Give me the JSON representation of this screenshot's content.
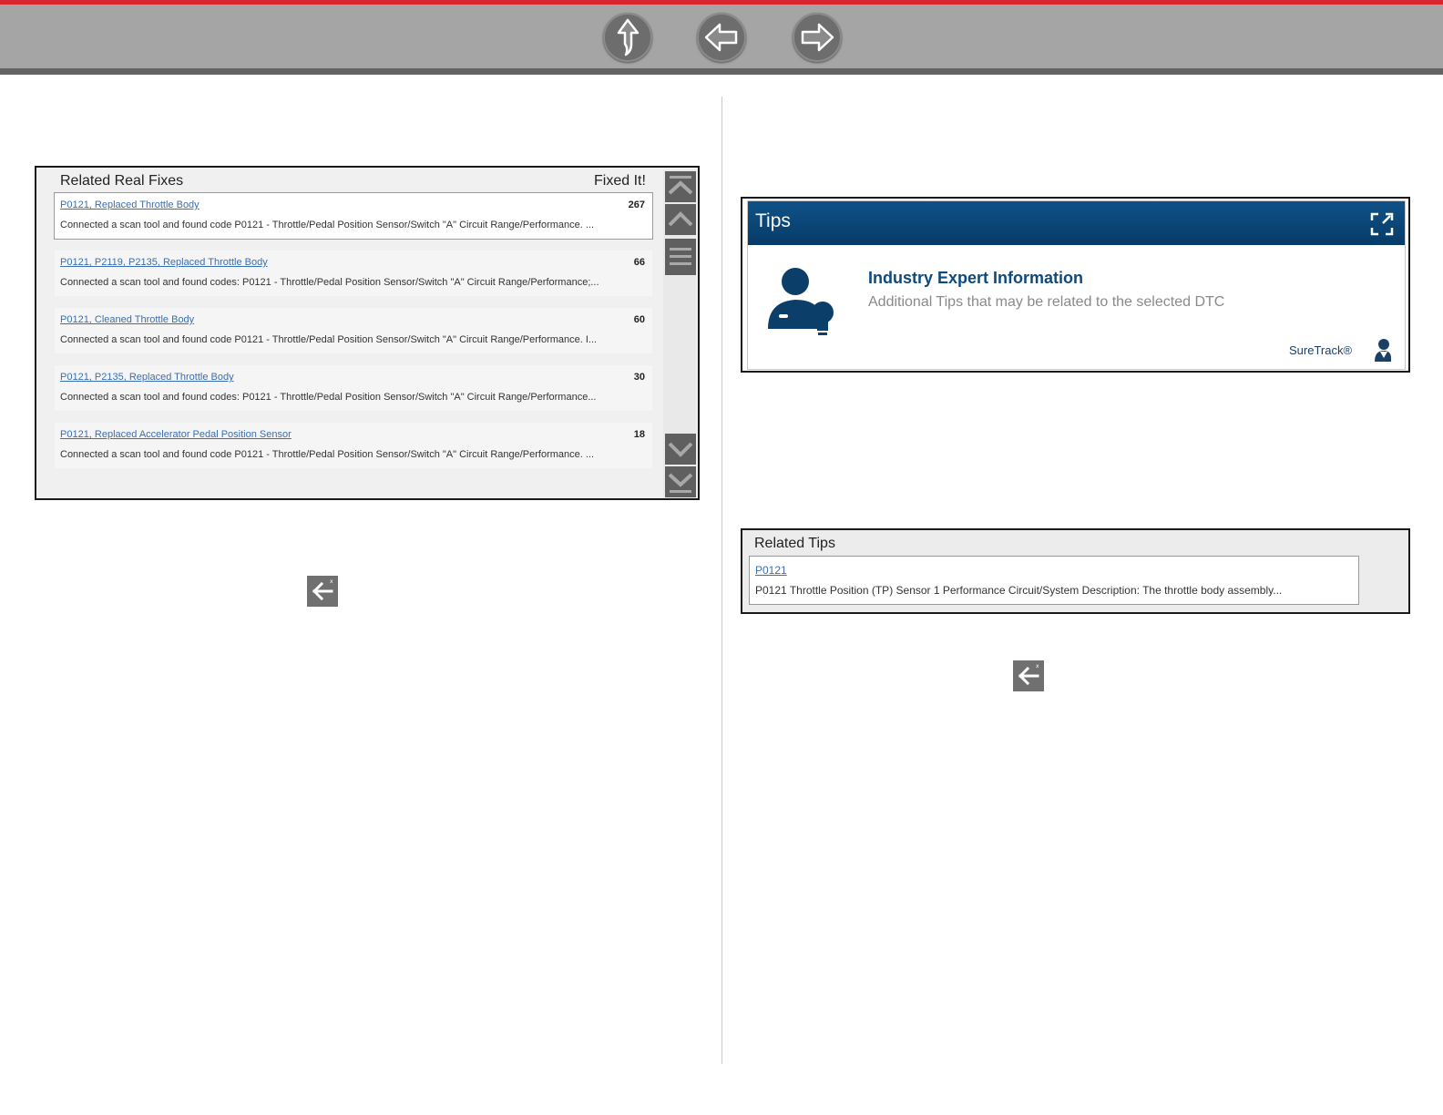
{
  "nav": {
    "buttons": [
      {
        "name": "home-button",
        "icon": "up-arrow-icon"
      },
      {
        "name": "back-button",
        "icon": "left-arrow-icon"
      },
      {
        "name": "forward-button",
        "icon": "right-arrow-icon"
      }
    ],
    "colors": {
      "bar": "#a5a5a5",
      "accent": "#d7262f",
      "button": "#6d6d6d"
    }
  },
  "related_fixes": {
    "title": "Related Real Fixes",
    "column_label": "Fixed It!",
    "items": [
      {
        "title": "P0121, Replaced Throttle Body",
        "count": "267",
        "description": "Connected a scan tool and found code P0121 - Throttle/Pedal Position Sensor/Switch \"A\" Circuit Range/Performance. ...",
        "selected": true
      },
      {
        "title": "P0121, P2119, P2135, Replaced Throttle Body",
        "count": "66",
        "description": "Connected a scan tool and found codes: P0121 - Throttle/Pedal Position Sensor/Switch \"A\" Circuit Range/Performance;...",
        "selected": false
      },
      {
        "title": "P0121, Cleaned Throttle Body",
        "count": "60",
        "description": "Connected a scan tool and found code P0121 - Throttle/Pedal Position Sensor/Switch \"A\" Circuit Range/Performance. I...",
        "selected": false
      },
      {
        "title": "P0121, P2135, Replaced Throttle Body",
        "count": "30",
        "description": "Connected a scan tool and found codes: P0121 - Throttle/Pedal Position Sensor/Switch \"A\" Circuit Range/Performance...",
        "selected": false
      },
      {
        "title": "P0121, Replaced Accelerator Pedal Position Sensor",
        "count": "18",
        "description": "Connected a scan tool and found code P0121 - Throttle/Pedal Position Sensor/Switch \"A\" Circuit Range/Performance. ...",
        "selected": false
      }
    ],
    "scroll_icons": [
      "scroll-top-icon",
      "scroll-up-icon",
      "scroll-thumb-icon",
      "scroll-down-icon",
      "scroll-bottom-icon"
    ]
  },
  "tips": {
    "title": "Tips",
    "heading": "Industry Expert Information",
    "subtitle": "Additional Tips that may be related to the selected DTC",
    "brand": "SureTrack®",
    "header_color": "#0b4a7d",
    "icons": [
      "expand-icon",
      "expert-icon",
      "suretrack-icon"
    ]
  },
  "related_tips": {
    "title": "Related Tips",
    "items": [
      {
        "title": "P0121",
        "description": "P0121 Throttle Position (TP) Sensor 1 Performance Circuit/System Description: The throttle body assembly..."
      }
    ]
  },
  "back_icons": [
    "back-icon",
    "back-icon"
  ]
}
